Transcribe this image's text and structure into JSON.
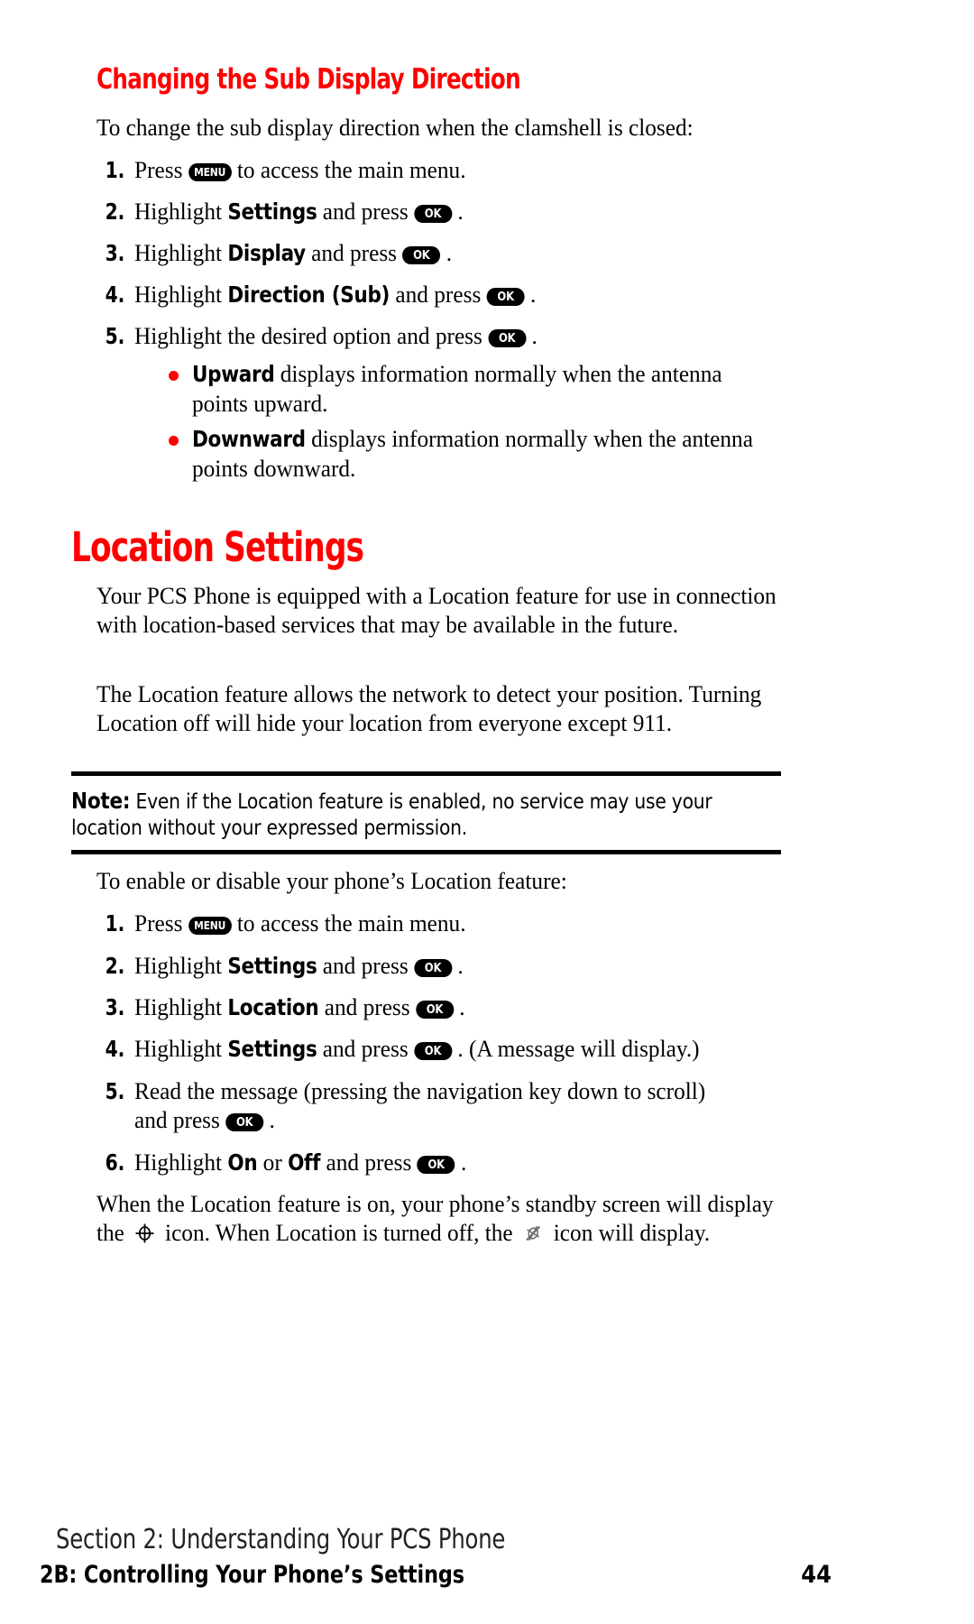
{
  "colors": {
    "heading_red": "#ff0000",
    "bullet_red": "#ff0000",
    "key_pill_bg": "#000000",
    "key_pill_text": "#ffffff",
    "body_text": "#000000",
    "page_background": "#ffffff"
  },
  "keys": {
    "ok": "OK",
    "menu": "MENU"
  },
  "sub_section": {
    "heading": "Changing the Sub Display Direction",
    "intro": "To change the sub display direction when the clamshell is closed:",
    "steps": [
      {
        "num": "1.",
        "pre": "Press ",
        "key": "MENU",
        "post": " to access the main menu."
      },
      {
        "num": "2.",
        "pre": "Highlight ",
        "keyword": "Settings",
        "mid": " and press ",
        "key": "OK",
        "post": " ."
      },
      {
        "num": "3.",
        "pre": "Highlight ",
        "keyword": "Display",
        "mid": " and press ",
        "key": "OK",
        "post": " ."
      },
      {
        "num": "4.",
        "pre": "Highlight ",
        "keyword": "Direction (Sub)",
        "mid": " and press ",
        "key": "OK",
        "post": " ."
      },
      {
        "num": "5.",
        "pre": "Highlight the desired option and press ",
        "key": "OK",
        "post": " ."
      }
    ],
    "bullets": [
      {
        "keyword": "Upward",
        "text": " displays information normally when the antenna points upward."
      },
      {
        "keyword": "Downward",
        "text": " displays information normally when the antenna points downward."
      }
    ]
  },
  "location_section": {
    "heading": "Location Settings",
    "paragraph1": "Your PCS Phone is equipped with a Location feature for use in connection with location-based services that may be available in the future.",
    "paragraph2": "The Location feature allows the network to detect your position. Turning Location off will hide your location from everyone except 911.",
    "note": {
      "label": "Note:",
      "text": " Even if the Location feature is enabled, no service may use your location without your expressed permission."
    },
    "intro": "To enable or disable your phone’s Location feature:",
    "steps": [
      {
        "num": "1.",
        "pre": "Press ",
        "key": "MENU",
        "post": " to access the main menu."
      },
      {
        "num": "2.",
        "pre": "Highlight ",
        "keyword": "Settings",
        "mid": " and press ",
        "key": "OK",
        "post": " ."
      },
      {
        "num": "3.",
        "pre": "Highlight ",
        "keyword": "Location",
        "mid": " and press ",
        "key": "OK",
        "post": " ."
      },
      {
        "num": "4.",
        "pre": "Highlight ",
        "keyword": "Settings",
        "mid": " and press ",
        "key": "OK",
        "post": " . (A message will display.)"
      },
      {
        "num": "5.",
        "pre": "Read the message (pressing the navigation key down to scroll)",
        "cont_pre": "and press ",
        "key": "OK",
        "post": " ."
      },
      {
        "num": "6.",
        "pre": "Highlight ",
        "keyword": "On",
        "mid2": " or ",
        "keyword2": "Off",
        "mid": " and press ",
        "key": "OK",
        "post": " ."
      }
    ],
    "closing": {
      "part1": "When the Location feature is on, your phone’s standby screen will display the ",
      "icon_on": "location-on-icon",
      "part2": " icon. When Location is turned off, the ",
      "icon_off": "location-off-icon",
      "part3": " icon will display."
    }
  },
  "footer": {
    "section": "Section 2: Understanding Your PCS Phone",
    "chapter": "2B: Controlling Your Phone’s Settings",
    "page_number": "44"
  }
}
